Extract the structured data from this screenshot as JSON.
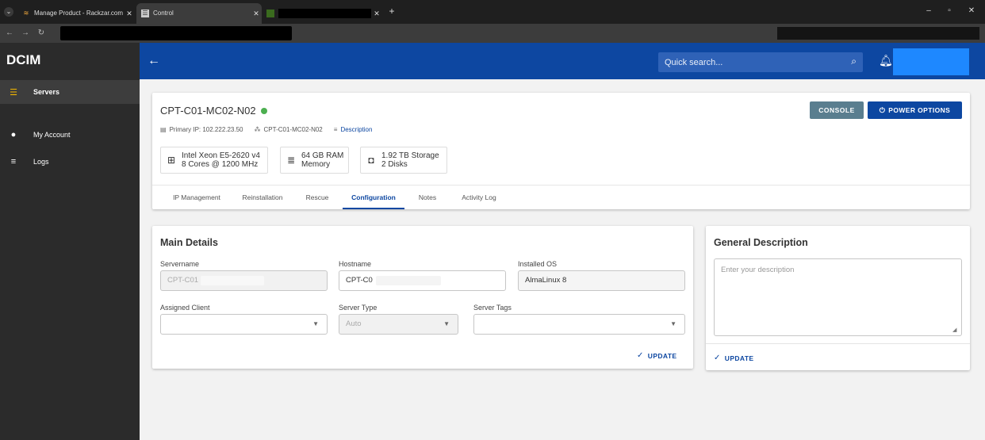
{
  "browser": {
    "tabs": [
      {
        "title": "Manage Product - Rackzar.com"
      },
      {
        "title": "Control"
      }
    ]
  },
  "sidebar": {
    "brand": "DCIM",
    "items": [
      {
        "label": "Servers"
      },
      {
        "label": "My Account"
      },
      {
        "label": "Logs"
      }
    ]
  },
  "header": {
    "search_placeholder": "Quick search..."
  },
  "server": {
    "name": "CPT-C01-MC02-N02",
    "primary_ip": "Primary IP: 102.222.23.50",
    "node": "CPT-C01-MC02-N02",
    "description_link": "Description",
    "cpu": {
      "line1": "Intel Xeon E5-2620 v4",
      "line2": "8 Cores @ 1200 MHz"
    },
    "ram": {
      "line1": "64 GB RAM",
      "line2": "Memory"
    },
    "storage": {
      "line1": "1.92 TB Storage",
      "line2": "2 Disks"
    },
    "console_label": "CONSOLE",
    "power_label": "POWER OPTIONS"
  },
  "tabs": [
    {
      "label": "IP Management"
    },
    {
      "label": "Reinstallation"
    },
    {
      "label": "Rescue"
    },
    {
      "label": "Configuration"
    },
    {
      "label": "Notes"
    },
    {
      "label": "Activity Log"
    }
  ],
  "main_details": {
    "title": "Main Details",
    "servername_label": "Servername",
    "servername_value": "CPT-C01",
    "hostname_label": "Hostname",
    "hostname_value": "CPT-C0",
    "os_label": "Installed OS",
    "os_value": "AlmaLinux 8",
    "client_label": "Assigned Client",
    "type_label": "Server Type",
    "type_value": "Auto",
    "tags_label": "Server Tags",
    "update_label": "UPDATE"
  },
  "general_description": {
    "title": "General Description",
    "placeholder": "Enter your description",
    "update_label": "UPDATE"
  },
  "colors": {
    "primary": "#0d47a1",
    "sidebar": "#2b2b2b",
    "status_online": "#4caf50",
    "console_button": "#5a7e8f"
  }
}
